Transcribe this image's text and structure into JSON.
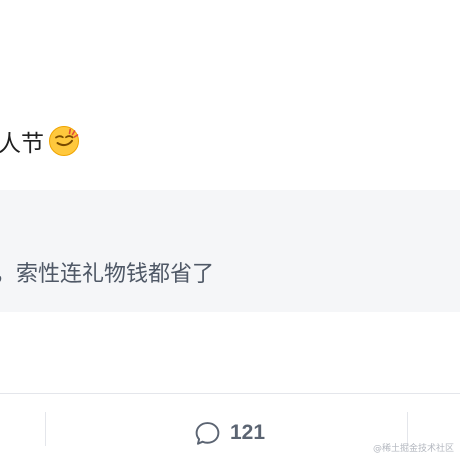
{
  "post": {
    "text": "人节",
    "emoji": "smirking-face-emoji"
  },
  "quote": {
    "text": "，索性连礼物钱都省了"
  },
  "actions": {
    "comment_icon": "comment-bubble-icon",
    "comment_count": "121"
  },
  "watermark": {
    "text": "@稀土掘金技术社区"
  },
  "colors": {
    "quote_background": "#f5f6f8",
    "divider": "#e4e6eb",
    "action_text": "#5b6472"
  }
}
